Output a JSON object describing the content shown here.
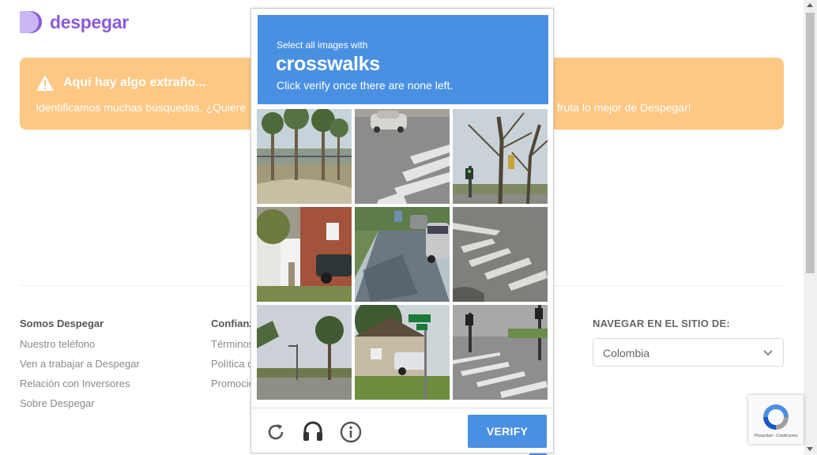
{
  "brand": {
    "name": "despegar",
    "color": "#8b5cd6"
  },
  "alert": {
    "title": "Aquí hay algo extraño...",
    "message": "Identificamos muchas búsquedas. ¿Quiere",
    "message_end": "fruta lo mejor de Despegar!",
    "background": "#fdc784"
  },
  "footer": {
    "col1": {
      "heading": "Somos Despegar",
      "links": [
        "Nuestro teléfono",
        "Ven a trabajar a Despegar",
        "Relación con Inversores",
        "Sobre Despegar"
      ]
    },
    "col2": {
      "heading": "Confianz",
      "links": [
        "Términos",
        "Política c",
        "Promocio"
      ]
    },
    "nav": {
      "heading": "NAVEGAR EN EL SITIO DE:",
      "selected": "Colombia"
    }
  },
  "captcha": {
    "instruction_small": "Select all images with",
    "target": "crosswalks",
    "instruction_sub": "Click verify once there are none left.",
    "verify_label": "VERIFY",
    "accent": "#4a90e2",
    "tiles": [
      {
        "scene": "palm trees parking lot"
      },
      {
        "scene": "road with car and crosswalk"
      },
      {
        "scene": "bare trees traffic light"
      },
      {
        "scene": "brick building with car"
      },
      {
        "scene": "street with parked cars"
      },
      {
        "scene": "crosswalk stripes on asphalt"
      },
      {
        "scene": "street light and palm"
      },
      {
        "scene": "house with street sign"
      },
      {
        "scene": "intersection crosswalk"
      }
    ],
    "icons": [
      "reload-icon",
      "audio-icon",
      "info-icon"
    ]
  },
  "recaptcha_badge": {
    "text": "Privacidad - Condiciones"
  }
}
